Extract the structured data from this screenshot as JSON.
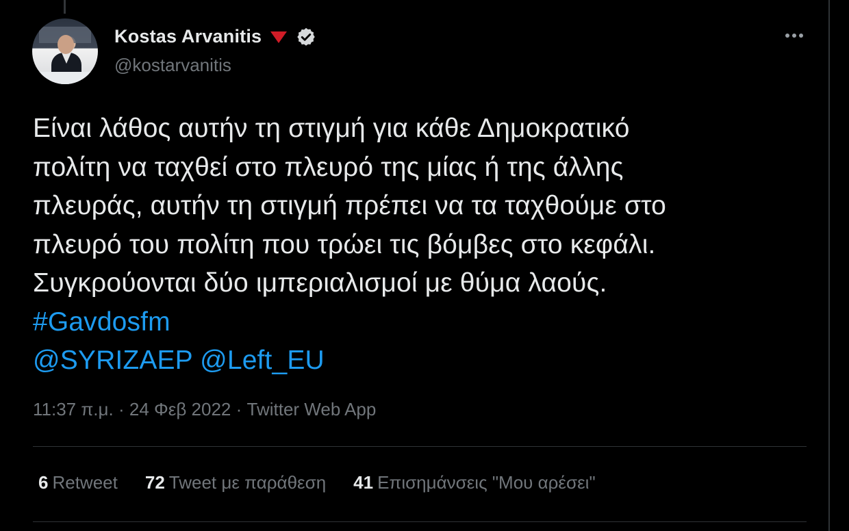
{
  "author": {
    "display_name": "Kostas Arvanitis",
    "handle": "@kostarvanitis"
  },
  "tweet": {
    "lines": [
      "Είναι λάθος αυτήν τη στιγμή για κάθε Δημοκρατικό",
      "πολίτη να ταχθεί στο πλευρό της μίας ή της άλλης",
      "πλευράς, αυτήν τη στιγμή πρέπει να τα ταχθούμε στο",
      "πλευρό του πολίτη που τρώει τις βόμβες στο κεφάλι.",
      "Συγκρούονται δύο ιμπεριαλισμοί με θύμα λαούς."
    ],
    "hashtag": "#Gavdosfm",
    "mention_1": "@SYRIZAEP",
    "mention_2": "@Left_EU"
  },
  "meta": {
    "time": "11:37 π.μ.",
    "separator": "·",
    "date": "24 Φεβ 2022",
    "source": "Twitter Web App"
  },
  "stats": {
    "retweets_count": "6",
    "retweets_label": "Retweet",
    "quotes_count": "72",
    "quotes_label": "Tweet με παράθεση",
    "likes_count": "41",
    "likes_label": "Επισημάνσεις \"Μου αρέσει\""
  },
  "icons": {
    "flag": "red-triangle-flag-icon",
    "verified": "verified-badge-icon",
    "more": "more-dots-icon"
  },
  "colors": {
    "background": "#000000",
    "text": "#e7e9ea",
    "secondary": "#71767b",
    "link": "#1d9bf0",
    "flag": "#f4212e",
    "divider": "#2f3336"
  }
}
